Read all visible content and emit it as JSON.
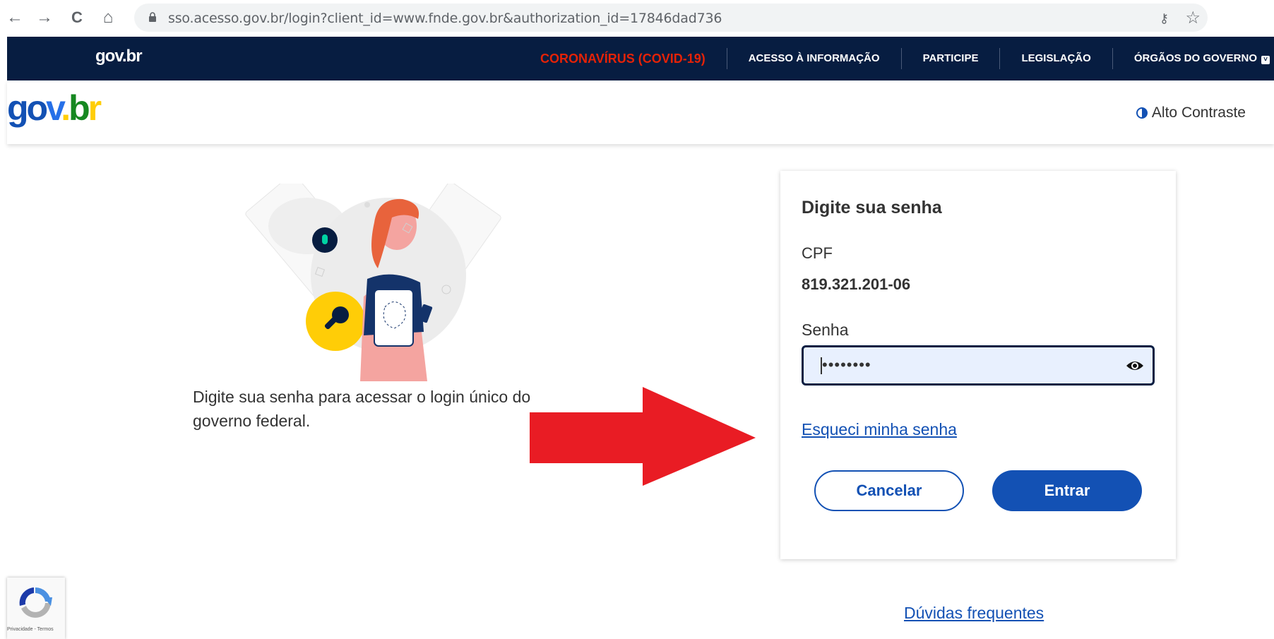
{
  "browser": {
    "url": "sso.acesso.gov.br/login?client_id=www.fnde.gov.br&authorization_id=17846dad736",
    "back_icon": "←",
    "forward_icon": "→",
    "reload_icon": "C",
    "home_icon": "⌂",
    "key_icon": "⚷",
    "star_icon": "☆"
  },
  "topnav": {
    "logo": "gov.br",
    "links": [
      "CORONAVÍRUS (COVID-19)",
      "ACESSO À INFORMAÇÃO",
      "PARTICIPE",
      "LEGISLAÇÃO",
      "ÓRGÃOS DO GOVERNO"
    ],
    "dropdown_icon": "˅"
  },
  "header": {
    "logo_parts": [
      "g",
      "o",
      "v",
      ".",
      "b",
      "r"
    ],
    "contrast_label": "Alto Contraste"
  },
  "main": {
    "intro_text": "Digite sua senha para acessar o login único do governo federal."
  },
  "card": {
    "title": "Digite sua senha",
    "cpf_label": "CPF",
    "cpf_value": "819.321.201-06",
    "password_label": "Senha",
    "password_value": "••••••••",
    "forgot_link": "Esqueci minha senha",
    "cancel_button": "Cancelar",
    "enter_button": "Entrar"
  },
  "footer": {
    "faq_link": "Dúvidas frequentes",
    "recaptcha_text": "Privacidade - Termos"
  },
  "colors": {
    "navy": "#071d41",
    "primary_blue": "#1351b4",
    "covid_red": "#e52207",
    "arrow_red": "#e91c24",
    "input_bg": "#e8f0fe",
    "key_yellow": "#ffcd07"
  }
}
